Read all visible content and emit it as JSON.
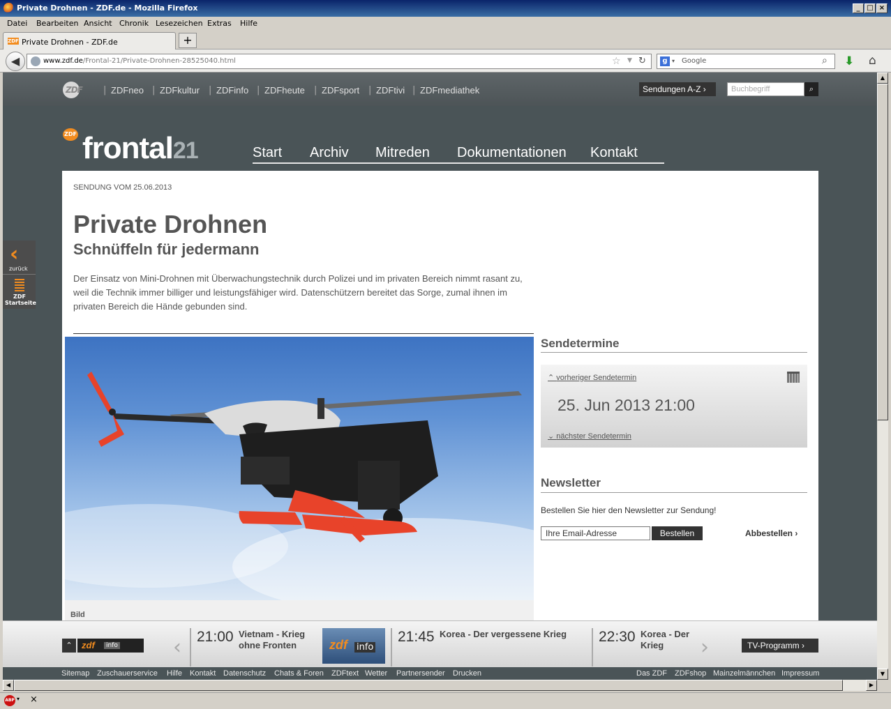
{
  "window": {
    "title": "Private Drohnen - ZDF.de - Mozilla Firefox"
  },
  "menu": [
    "Datei",
    "Bearbeiten",
    "Ansicht",
    "Chronik",
    "Lesezeichen",
    "Extras",
    "Hilfe"
  ],
  "tab": {
    "label": "Private Drohnen - ZDF.de",
    "new_tab": "+"
  },
  "nav": {
    "url_host": "www.zdf.de",
    "url_path": "/Frontal-21/Private-Drohnen-28525040.html",
    "search_engine": "Google"
  },
  "zdfbar": {
    "channels": [
      "ZDFneo",
      "ZDFkultur",
      "ZDFinfo",
      "ZDFheute",
      "ZDFsport",
      "ZDFtivi",
      "ZDFmediathek"
    ],
    "az_button": "Sendungen A-Z",
    "search_placeholder": "Buchbegriff"
  },
  "header": {
    "brand": "frontal",
    "brand_num": "21",
    "mainnav": [
      "Start",
      "Archiv",
      "Mitreden",
      "Dokumentationen",
      "Kontakt"
    ]
  },
  "sidewidget": {
    "back_label": "zurück",
    "home_label": "ZDF Startseite"
  },
  "article": {
    "date": "SENDUNG VOM 25.06.2013",
    "title": "Private Drohnen",
    "subtitle": "Schnüffeln für jedermann",
    "teaser": "Der Einsatz von Mini-Drohnen mit Überwachungstechnik durch Polizei und im privaten Bereich nimmt rasant zu, weil die Technik immer billiger und leistungsfähiger wird. Datenschützern bereitet das Sorge, zumal ihnen im privaten Bereich die Hände gebunden sind.",
    "caption": "Bild"
  },
  "sendetermine": {
    "heading": "Sendetermine",
    "prev": "vorheriger Sendetermin",
    "date": "25. Jun 2013 21:00",
    "next": "nächster Sendetermin"
  },
  "newsletter": {
    "heading": "Newsletter",
    "text": "Bestellen Sie hier den Newsletter zur Sendung!",
    "input_value": "Ihre Email-Adresse",
    "order_btn": "Bestellen",
    "unsubscribe": "Abbestellen"
  },
  "tvbar": {
    "channel_logo": "zdf",
    "channel_sub": "info",
    "items": [
      {
        "time": "21:00",
        "title": "Vietnam - Krieg ohne Fronten"
      },
      {
        "time": "21:45",
        "title": "Korea - Der vergessene Krieg"
      },
      {
        "time": "22:30",
        "title": "Korea - Der Krieg"
      }
    ],
    "tv_program": "TV-Programm"
  },
  "footer": {
    "left": [
      "Sitemap",
      "Zuschauerservice",
      "Hilfe",
      "Kontakt",
      "Datenschutz",
      "Chats & Foren",
      "ZDFtext",
      "Wetter",
      "Partnersender",
      "Drucken"
    ],
    "right": [
      "Das ZDF",
      "ZDFshop",
      "Mainzelmännchen",
      "Impressum"
    ]
  },
  "colors": {
    "accent": "#f28c1f",
    "page_bg": "#4a5457",
    "drone_red": "#e8432a"
  }
}
